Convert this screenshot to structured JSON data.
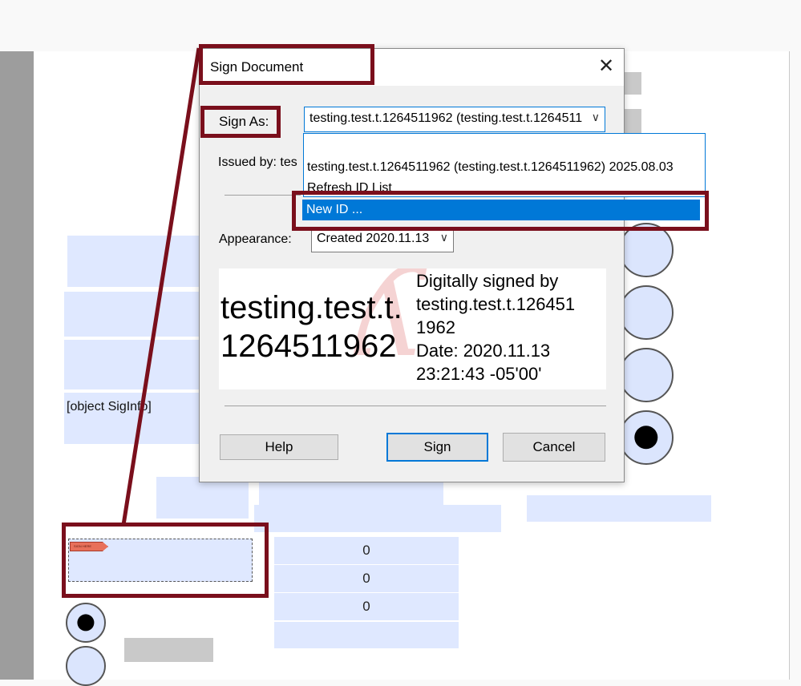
{
  "document": {
    "field_text": "[object SigInfo]",
    "numbers": [
      "0",
      "0",
      "0"
    ],
    "signature_tag": "SIGN HERE"
  },
  "dialog": {
    "title": "Sign Document",
    "close_glyph": "✕",
    "sign_as_label": "Sign As:",
    "sign_as_value": "testing.test.t.1264511962 (testing.test.t.1264511962) 2025.08.03",
    "issued_by_label": "Issued by: tes",
    "appearance_label": "Appearance:",
    "appearance_value": "Created 2020.11.13",
    "chevron": "∨",
    "preview": {
      "name_line1": "testing.test.t.",
      "name_line2": "1264511962",
      "detail_lines": [
        "Digitally signed by",
        "testing.test.t.126451",
        "1962",
        "Date: 2020.11.13",
        "23:21:43 -05'00'"
      ]
    },
    "buttons": {
      "help": "Help",
      "sign": "Sign",
      "cancel": "Cancel"
    }
  },
  "dropdown": {
    "items": [
      "testing.test.t.1264511962 (testing.test.t.1264511962) 2025.08.03",
      "Refresh ID List",
      "New ID ..."
    ],
    "selected_index": 2
  },
  "colors": {
    "callout": "#7a0f1c",
    "accent": "#0078d7",
    "field": "#dfe8ff"
  }
}
